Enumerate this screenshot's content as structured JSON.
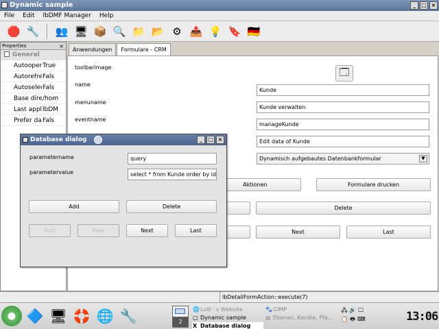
{
  "window": {
    "title": "Dynamic sample"
  },
  "menu": [
    "File",
    "Edit",
    "lbDMF Manager",
    "Help"
  ],
  "toolbar": {
    "icons": [
      "🛑",
      "🔧",
      "👥",
      "🖥",
      "📦",
      "🔍",
      "📁",
      "📂",
      "⚙",
      "📤",
      "💡",
      "🔖",
      "🇩🇪"
    ]
  },
  "properties": {
    "header": "Properties",
    "close": "×",
    "group": "General",
    "rows": [
      {
        "key": "Autoopen last",
        "value": "True"
      },
      {
        "key": "Autorefresh up",
        "value": "Fals"
      },
      {
        "key": "Autoselect last",
        "value": "Fals"
      },
      {
        "key": "Base directory",
        "value": "/hom"
      },
      {
        "key": "Last application",
        "value": "lbDM"
      },
      {
        "key": "Prefer databas",
        "value": "Fals"
      }
    ]
  },
  "tabs": [
    "Anwendungen",
    "Formulare - CRM"
  ],
  "form": {
    "labels": {
      "toolbarimage": "toolbarimage",
      "name": "name",
      "menuname": "menuname",
      "eventname": "eventname"
    },
    "values": {
      "name": "Kunde",
      "menuname": "Kunde verwalten",
      "eventname": "manageKunde",
      "description": "Edit data of Kunde",
      "type": "Dynamisch aufgebautes Datenbankformular"
    },
    "buttons": {
      "aktionen": "Aktionen",
      "drucken": "Formulare drucken",
      "delete": "Delete",
      "next": "Next",
      "last": "Last"
    }
  },
  "status": {
    "text": "lbDetailFormAction::execute(7)"
  },
  "dialog": {
    "title": "Database dialog",
    "param_name_label": "parametername",
    "param_value_label": "parametervalue",
    "param_name": "query",
    "param_value": "select * from Kunde order by id",
    "buttons": {
      "add": "Add",
      "delete": "Delete",
      "first": "First",
      "prev": "Prev",
      "next": "Next",
      "last": "Last"
    }
  },
  "taskbar": {
    "pager_number": "2",
    "tasks": {
      "t1": "Lolli ' s Website",
      "t2": "Dynamic sample",
      "t3": "Database dialog",
      "t4": "GIMP",
      "t5": "Ebenen, Kanäle, Pfa..."
    },
    "clock": "13:06"
  }
}
